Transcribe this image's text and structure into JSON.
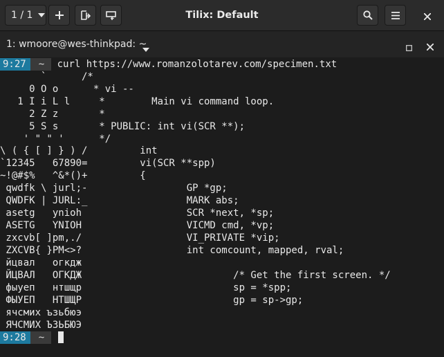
{
  "header": {
    "session_label": "1 / 1",
    "title": "Tilix: Default"
  },
  "terminal_bar": {
    "title": "1: wmoore@wes-thinkpad: ~"
  },
  "prompts": [
    {
      "time": "9:27",
      "dir": "~",
      "command": "curl https://www.romanzolotarev.com/specimen.txt"
    },
    {
      "time": "9:28",
      "dir": "~",
      "command": ""
    }
  ],
  "output_lines": [
    "       `      /*",
    "     0 O o      * vi --",
    "   1 I i L l     *        Main vi command loop.",
    "     2 Z z       *",
    "     5 S s       * PUBLIC: int vi(SCR **);",
    "    ' \" \" '      */",
    "\\ ( { [ ] } ) /         int",
    "`12345   67890=         vi(SCR **spp)",
    "~!@#$%   ^&*()+         {",
    " qwdfk \\ jurl;-                 GP *gp;",
    " QWDFK | JURL:_                 MARK abs;",
    " asetg   ynioh                  SCR *next, *sp;",
    " ASETG   YNIOH                  VICMD cmd, *vp;",
    " zxcvb[ ]pm,./                  VI_PRIVATE *vip;",
    " ZXCVB{ }PM<>?                  int comcount, mapped, rval;",
    " йцвал   огкдж",
    " ЙЦВАЛ   ОГКДЖ                          /* Get the first screen. */",
    " фыуеп   нтшщр                          sp = *spp;",
    " ФЫУЕП   НТШЩР                          gp = sp->gp;",
    " ячсмих ъзьбюэ",
    " ЯЧСМИХ ЪЗЬБЮЭ"
  ],
  "colors": {
    "prompt_time_bg": "#1d7a9f",
    "prompt_dir_bg": "#3a3a3a",
    "terminal_bg": "#1c1c1c",
    "headerbar_bg": "#2b2b2b"
  },
  "icons": {
    "session_dropdown": "chevron-down-icon",
    "add_terminal": "plus-icon",
    "split_right": "split-horizontal-icon",
    "split_down": "split-vertical-icon",
    "search": "search-icon",
    "menu": "hamburger-menu-icon",
    "window_close": "close-icon",
    "terminal_dropdown": "chevron-down-icon",
    "terminal_maximize": "maximize-icon",
    "terminal_close": "close-icon"
  }
}
